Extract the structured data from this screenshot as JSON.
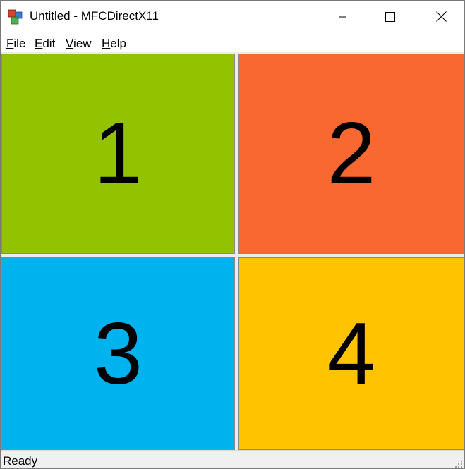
{
  "window": {
    "title": "Untitled - MFCDirectX11"
  },
  "menu": [
    {
      "accel": "F",
      "rest": "ile"
    },
    {
      "accel": "E",
      "rest": "dit"
    },
    {
      "accel": "V",
      "rest": "iew"
    },
    {
      "accel": "H",
      "rest": "elp"
    }
  ],
  "panes": [
    {
      "number": "1",
      "color": "#92c200"
    },
    {
      "number": "2",
      "color": "#f96831"
    },
    {
      "number": "3",
      "color": "#00b2ee"
    },
    {
      "number": "4",
      "color": "#ffc300"
    }
  ],
  "status": {
    "text": "Ready"
  },
  "icons": {
    "app": "mfc-app-icon",
    "minimize": "minimize-icon",
    "maximize": "maximize-icon",
    "close": "close-icon",
    "grip": "resize-grip-icon"
  }
}
